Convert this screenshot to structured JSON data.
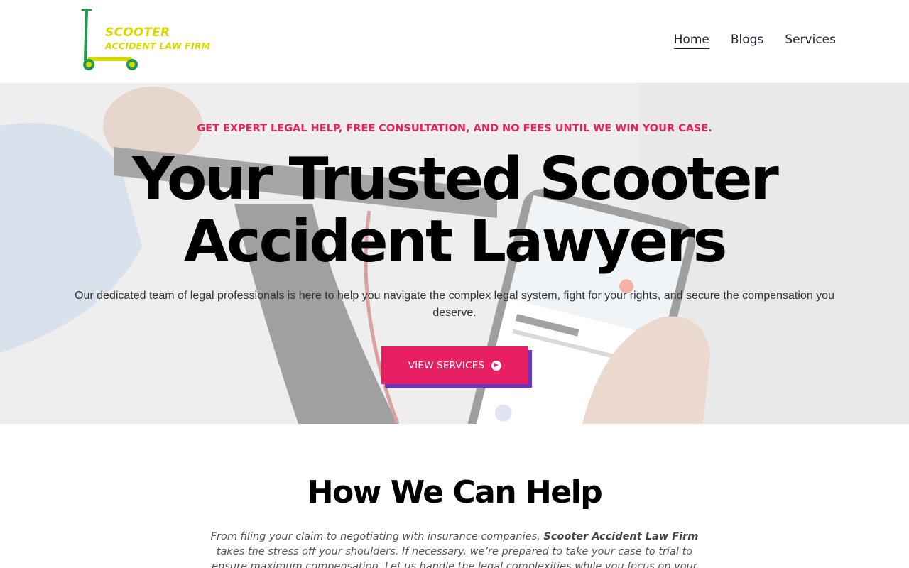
{
  "header": {
    "logo": {
      "line1": "SCOOTER",
      "line2": "ACCIDENT LAW FIRM",
      "icon": "scooter-icon",
      "colors": {
        "text": "#d6d800",
        "scooter_frame": "#1f9a4c",
        "scooter_deck": "#d6d800"
      }
    },
    "nav": [
      {
        "label": "Home",
        "active": true
      },
      {
        "label": "Blogs",
        "active": false
      },
      {
        "label": "Services",
        "active": false
      }
    ]
  },
  "hero": {
    "eyebrow": "GET EXPERT LEGAL HELP, FREE CONSULTATION, AND NO FEES UNTIL WE WIN YOUR CASE.",
    "title_line1": "Your Trusted Scooter",
    "title_line2": "Accident Lawyers",
    "subtitle": "Our dedicated team of legal professionals is here to help you navigate the complex legal system, fight for your rights, and secure the compensation you deserve.",
    "cta_label": "VIEW SERVICES",
    "cta_icon": "arrow-circle-right-icon",
    "colors": {
      "eyebrow": "#e8215f",
      "cta_bg": "#e81f63",
      "cta_shadow": "#6b35c4"
    }
  },
  "help": {
    "title": "How We Can Help",
    "text_before": "From filing your claim to negotiating with insurance companies, ",
    "text_bold": "Scooter Accident Law Firm",
    "text_after": " takes the stress off your shoulders. If necessary, we’re prepared to take your case to trial to ensure maximum compensation. Let us handle the legal complexities while you focus on your recovery."
  }
}
